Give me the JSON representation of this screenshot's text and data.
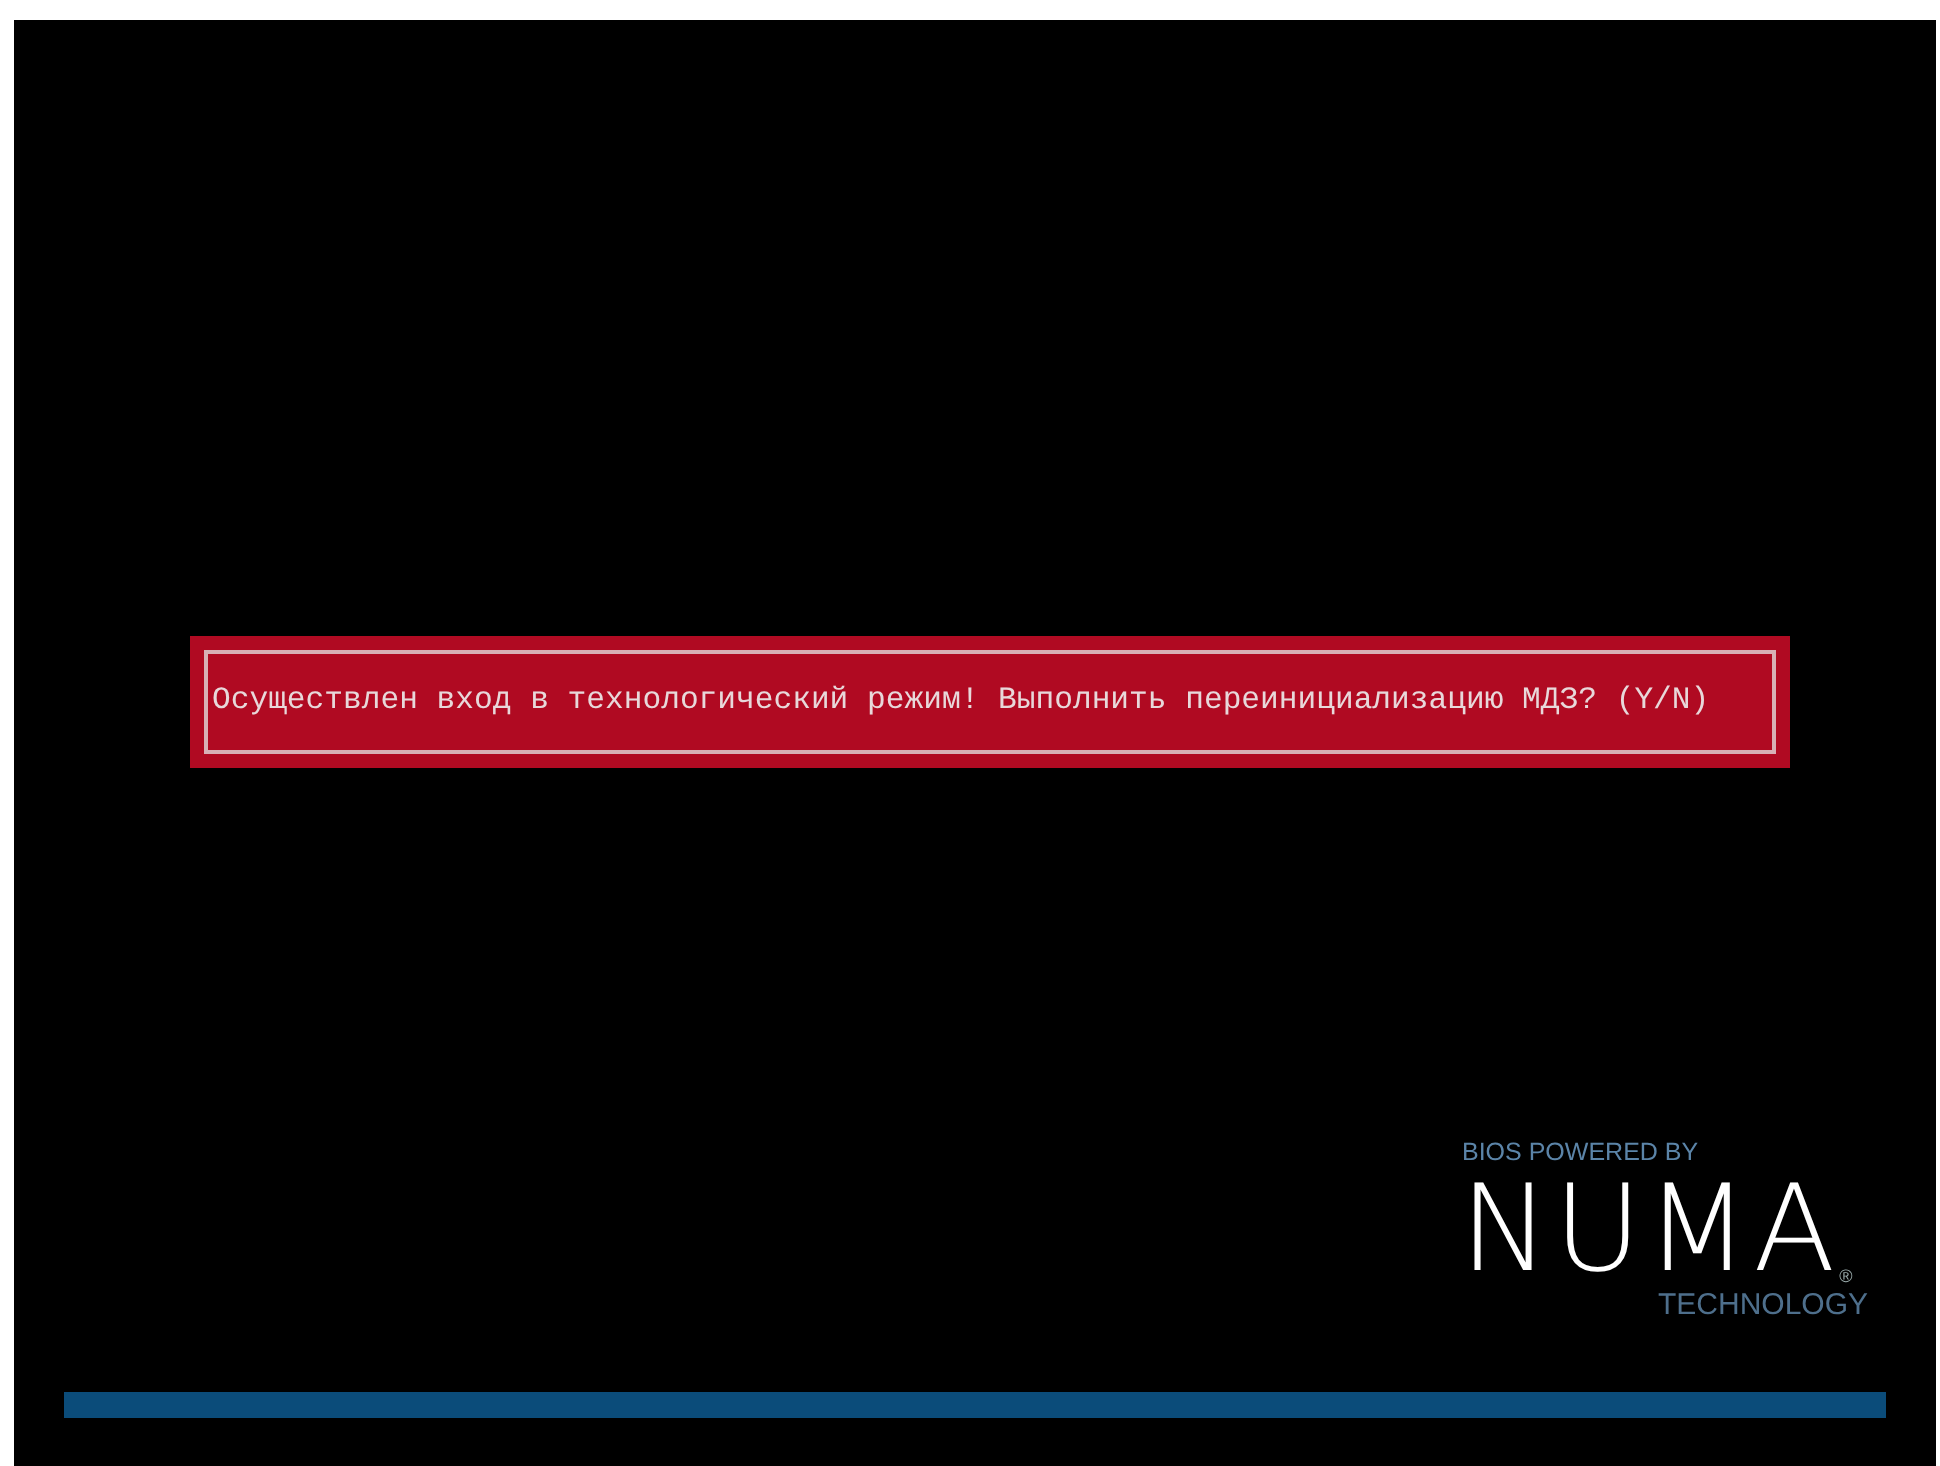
{
  "dialog": {
    "message": "Осуществлен вход в технологический режим! Выполнить переинициализацию МДЗ? (Y/N)"
  },
  "logo": {
    "caption": "BIOS POWERED BY",
    "wordmark": "NUMA",
    "registered": "®",
    "subtitle": "TECHNOLOGY"
  }
}
